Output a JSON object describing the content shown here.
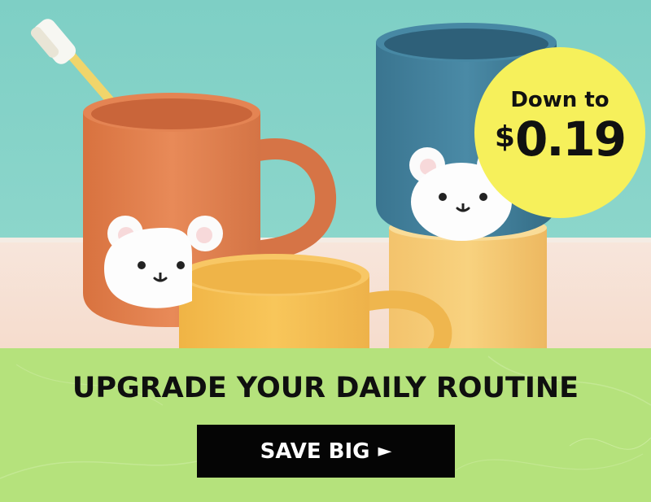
{
  "banner": {
    "headline": "UPGRADE YOUR DAILY ROUTINE",
    "cta_label": "SAVE BIG",
    "cta_arrow": "►",
    "badge": {
      "line1": "Down to",
      "currency": "$",
      "amount": "0.19"
    }
  },
  "colors": {
    "backdrop": "#7fcfc5",
    "panel": "#b5e27c",
    "badge": "#f6f05b",
    "cta_bg": "#050505",
    "cup_orange": "#e27d4c",
    "cup_blue": "#3f7b94",
    "cup_yellow": "#f4be4d"
  }
}
